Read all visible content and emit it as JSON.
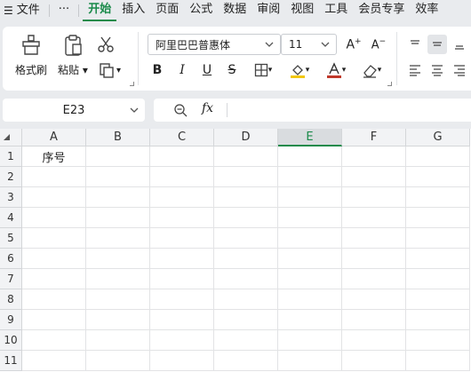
{
  "menu": {
    "file_label": "文件",
    "more_label": "···",
    "tabs": [
      "开始",
      "插入",
      "页面",
      "公式",
      "数据",
      "审阅",
      "视图",
      "工具",
      "会员专享",
      "效率"
    ],
    "active_tab": "开始"
  },
  "ribbon": {
    "format_painter_label": "格式刷",
    "paste_label": "粘贴",
    "font_name": "阿里巴巴普惠体",
    "font_size": "11",
    "bold_glyph": "B",
    "italic_glyph": "I",
    "underline_glyph": "U",
    "strike_glyph": "S",
    "font_color": "#c0392b",
    "fill_color": "#f2c811",
    "accent_color": "#1a8a4a"
  },
  "formula_bar": {
    "cell_reference": "E23",
    "fx_label": "fx",
    "formula_value": ""
  },
  "sheet": {
    "columns": [
      "A",
      "B",
      "C",
      "D",
      "E",
      "F",
      "G"
    ],
    "selected_column": "E",
    "rows": [
      "1",
      "2",
      "3",
      "4",
      "5",
      "6",
      "7",
      "8",
      "9",
      "10",
      "11"
    ],
    "cells": {
      "A1": "序号"
    }
  }
}
